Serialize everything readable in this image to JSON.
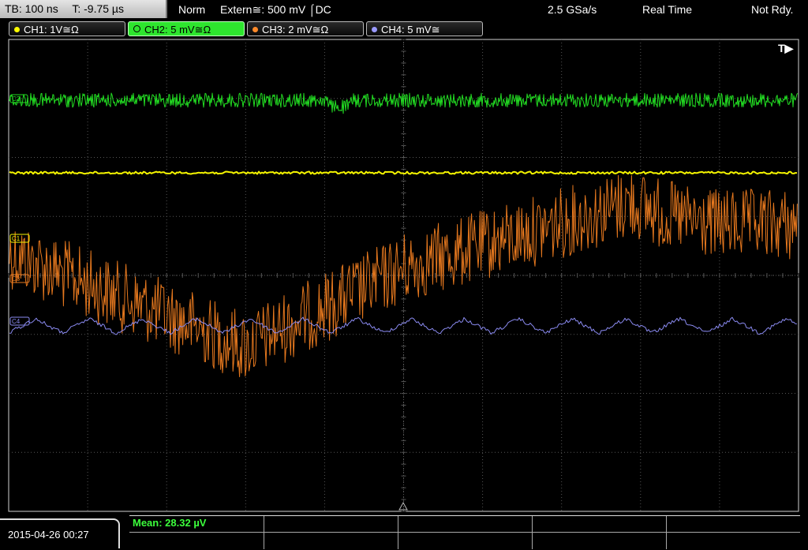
{
  "topbar": {
    "timebase": "TB: 100 ns",
    "trigger_time": "T: -9.75 µs",
    "mode": "Norm",
    "trigger_source": "Extern≅: 500 mV ⌠DC",
    "sample_rate": "2.5 GSa/s",
    "acq_mode": "Real Time",
    "state": "Not Rdy."
  },
  "channels": [
    {
      "label": "CH1: 1V≅Ω",
      "color": "#ffff00"
    },
    {
      "label": "CH2: 5 mV≅Ω",
      "color": "#2ee52e"
    },
    {
      "label": "CH3: 2 mV≅Ω",
      "color": "#ff8a2a"
    },
    {
      "label": "CH4: 5 mV≅",
      "color": "#9a9aff"
    }
  ],
  "markers": {
    "trigger": "T▶",
    "c1": "C1",
    "c2": "C2",
    "c3": "C3",
    "c4": "C4"
  },
  "bottom": {
    "datetime": "2015-04-26 00:27",
    "mean": "Mean: 28.32 µV"
  },
  "colors": {
    "ch1": "#f5f500",
    "ch2": "#22dd22",
    "ch3": "#e6781e",
    "ch4": "#8a8af0",
    "grid": "#555555"
  }
}
